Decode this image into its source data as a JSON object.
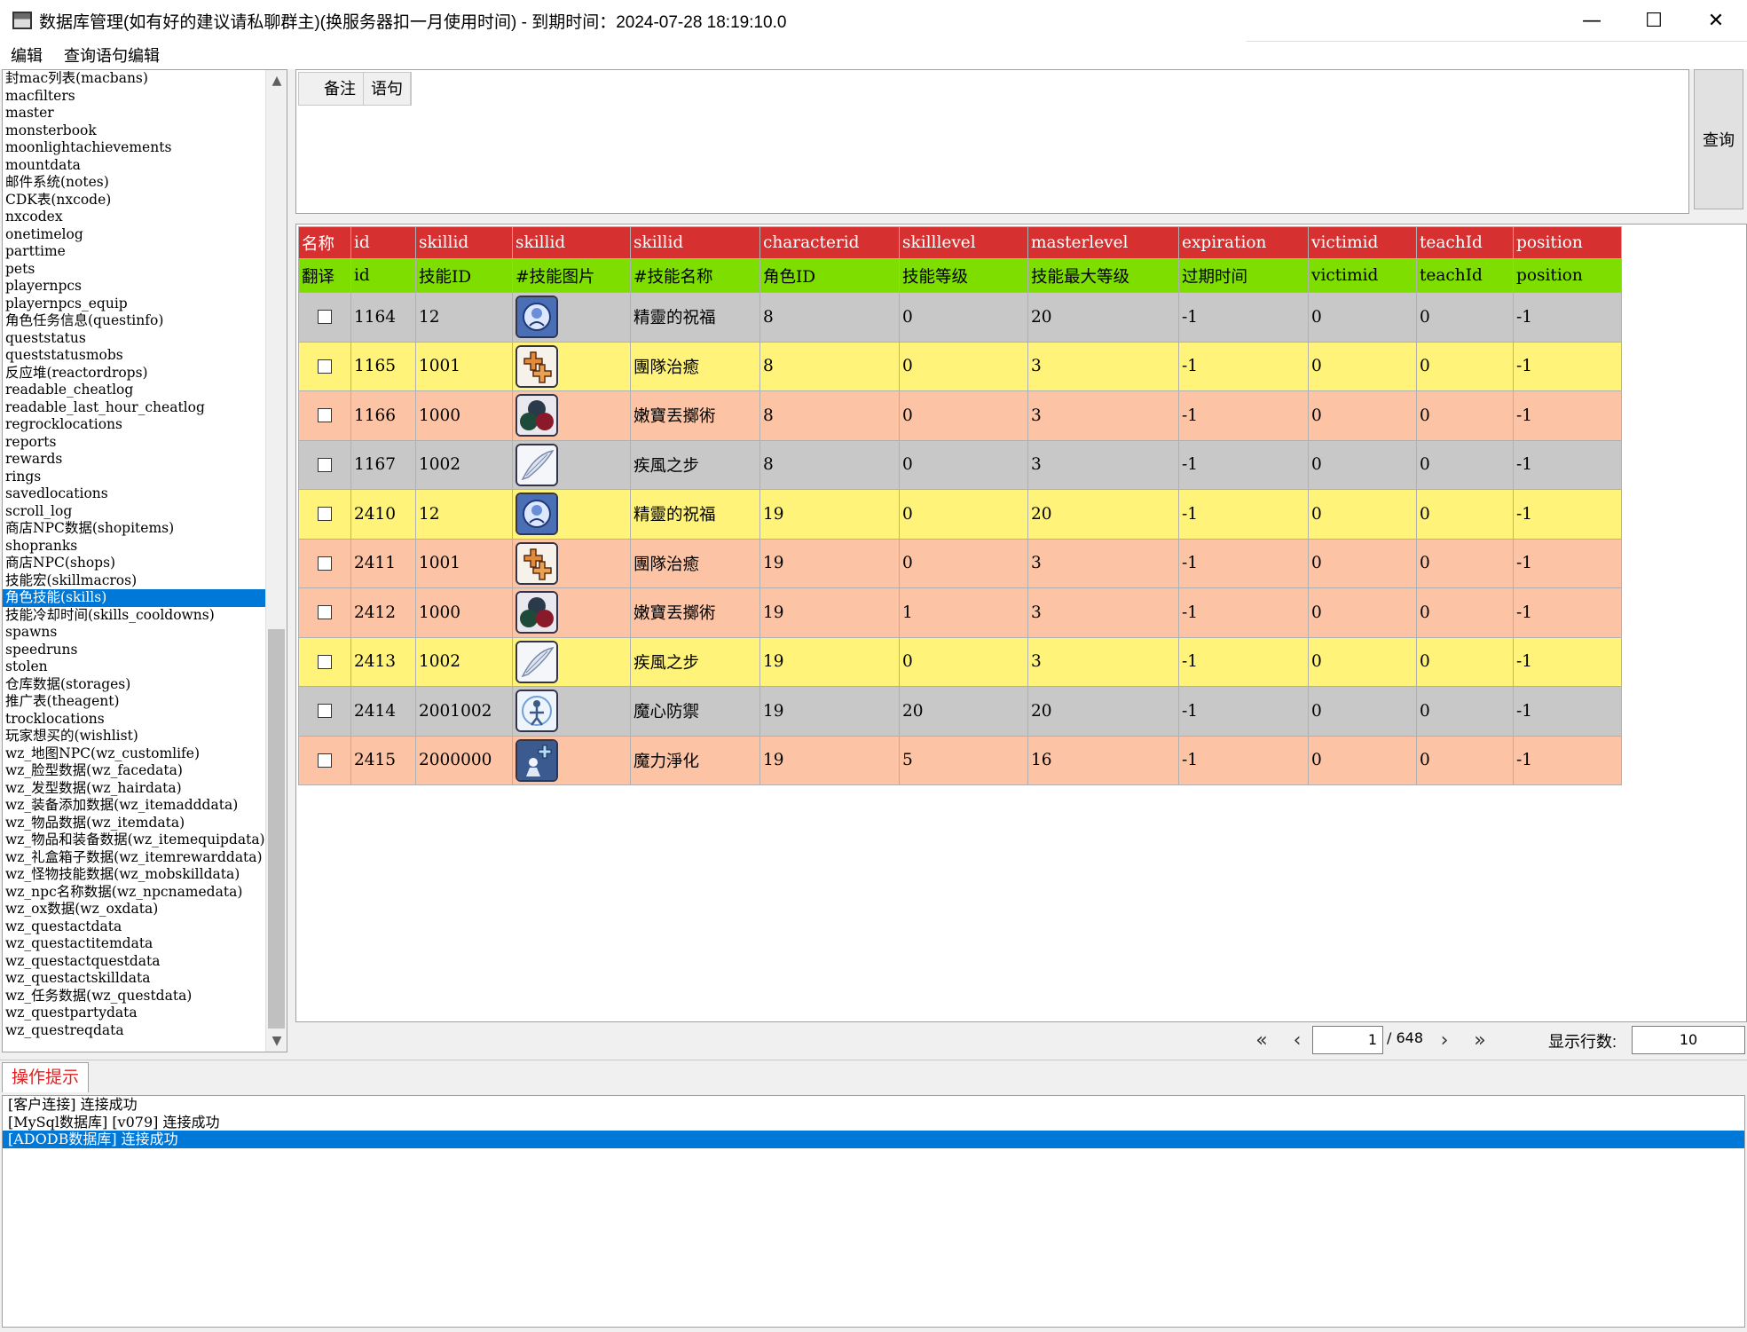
{
  "window": {
    "title": "数据库管理(如有好的建议请私聊群主)(换服务器扣一月使用时间) - 到期时间：2024-07-28 18:19:10.0",
    "minimize": "—",
    "maximize": "☐",
    "close": "✕"
  },
  "menu": [
    "编辑",
    "查询语句编辑"
  ],
  "table_list": {
    "selected_index": 30,
    "items": [
      "封mac列表(macbans)",
      "macfilters",
      "master",
      "monsterbook",
      "moonlightachievements",
      "mountdata",
      "邮件系统(notes)",
      "CDK表(nxcode)",
      "nxcodex",
      "onetimelog",
      "parttime",
      "pets",
      "playernpcs",
      "playernpcs_equip",
      "角色任务信息(questinfo)",
      "queststatus",
      "queststatusmobs",
      "反应堆(reactordrops)",
      "readable_cheatlog",
      "readable_last_hour_cheatlog",
      "regrocklocations",
      "reports",
      "rewards",
      "rings",
      "savedlocations",
      "scroll_log",
      "商店NPC数据(shopitems)",
      "shopranks",
      "商店NPC(shops)",
      "技能宏(skillmacros)",
      "角色技能(skills)",
      "技能冷却时间(skills_cooldowns)",
      "spawns",
      "speedruns",
      "stolen",
      "仓库数据(storages)",
      "推广表(theagent)",
      "trocklocations",
      "玩家想买的(wishlist)",
      "wz_地图NPC(wz_customlife)",
      "wz_脸型数据(wz_facedata)",
      "wz_发型数据(wz_hairdata)",
      "wz_装备添加数据(wz_itemadddata)",
      "wz_物品数据(wz_itemdata)",
      "wz_物品和装备数据(wz_itemequipdata)",
      "wz_礼盒箱子数据(wz_itemrewarddata)",
      "wz_怪物技能数据(wz_mobskilldata)",
      "wz_npc名称数据(wz_npcnamedata)",
      "wz_ox数据(wz_oxdata)",
      "wz_questactdata",
      "wz_questactitemdata",
      "wz_questactquestdata",
      "wz_questactskilldata",
      "wz_任务数据(wz_questdata)",
      "wz_questpartydata",
      "wz_questreqdata"
    ]
  },
  "query": {
    "tabs": [
      "备注",
      "语句"
    ],
    "button": "查询"
  },
  "grid": {
    "header_names": [
      "名称",
      "id",
      "skillid",
      "skillid",
      "skillid",
      "characterid",
      "skilllevel",
      "masterlevel",
      "expiration",
      "victimid",
      "teachId",
      "position"
    ],
    "header_translations": [
      "翻译",
      "id",
      "技能ID",
      "#技能图片",
      "#技能名称",
      "角色ID",
      "技能等级",
      "技能最大等级",
      "过期时间",
      "victimid",
      "teachId",
      "position"
    ],
    "rows": [
      {
        "id": "1164",
        "skillid": "12",
        "icon": "blessing-icon",
        "name": "精靈的祝福",
        "characterid": "8",
        "skilllevel": "0",
        "masterlevel": "20",
        "expiration": "-1",
        "victimid": "0",
        "teachid": "0",
        "position": "-1",
        "color": "gray"
      },
      {
        "id": "1165",
        "skillid": "1001",
        "icon": "heal-icon",
        "name": "團隊治癒",
        "characterid": "8",
        "skilllevel": "0",
        "masterlevel": "3",
        "expiration": "-1",
        "victimid": "0",
        "teachid": "0",
        "position": "-1",
        "color": "yellow"
      },
      {
        "id": "1166",
        "skillid": "1000",
        "icon": "stone-throw-icon",
        "name": "嫩寶丟擲術",
        "characterid": "8",
        "skilllevel": "0",
        "masterlevel": "3",
        "expiration": "-1",
        "victimid": "0",
        "teachid": "0",
        "position": "-1",
        "color": "salmon"
      },
      {
        "id": "1167",
        "skillid": "1002",
        "icon": "wing-icon",
        "name": "疾風之步",
        "characterid": "8",
        "skilllevel": "0",
        "masterlevel": "3",
        "expiration": "-1",
        "victimid": "0",
        "teachid": "0",
        "position": "-1",
        "color": "gray"
      },
      {
        "id": "2410",
        "skillid": "12",
        "icon": "blessing-icon",
        "name": "精靈的祝福",
        "characterid": "19",
        "skilllevel": "0",
        "masterlevel": "20",
        "expiration": "-1",
        "victimid": "0",
        "teachid": "0",
        "position": "-1",
        "color": "yellow"
      },
      {
        "id": "2411",
        "skillid": "1001",
        "icon": "heal-icon",
        "name": "團隊治癒",
        "characterid": "19",
        "skilllevel": "0",
        "masterlevel": "3",
        "expiration": "-1",
        "victimid": "0",
        "teachid": "0",
        "position": "-1",
        "color": "salmon"
      },
      {
        "id": "2412",
        "skillid": "1000",
        "icon": "stone-throw-icon",
        "name": "嫩寶丟擲術",
        "characterid": "19",
        "skilllevel": "1",
        "masterlevel": "3",
        "expiration": "-1",
        "victimid": "0",
        "teachid": "0",
        "position": "-1",
        "color": "salmon"
      },
      {
        "id": "2413",
        "skillid": "1002",
        "icon": "wing-icon",
        "name": "疾風之步",
        "characterid": "19",
        "skilllevel": "0",
        "masterlevel": "3",
        "expiration": "-1",
        "victimid": "0",
        "teachid": "0",
        "position": "-1",
        "color": "yellow"
      },
      {
        "id": "2414",
        "skillid": "2001002",
        "icon": "magic-guard-icon",
        "name": "魔心防禦",
        "characterid": "19",
        "skilllevel": "20",
        "masterlevel": "20",
        "expiration": "-1",
        "victimid": "0",
        "teachid": "0",
        "position": "-1",
        "color": "gray"
      },
      {
        "id": "2415",
        "skillid": "2000000",
        "icon": "mp-recovery-icon",
        "name": "魔力淨化",
        "characterid": "19",
        "skilllevel": "5",
        "masterlevel": "16",
        "expiration": "-1",
        "victimid": "0",
        "teachid": "0",
        "position": "-1",
        "color": "salmon"
      }
    ]
  },
  "pager": {
    "first": "«",
    "prev": "‹",
    "next": "›",
    "last": "»",
    "current_page": "1",
    "total_pages": "/ 648",
    "rows_label": "显示行数:",
    "rows_per_page": "10"
  },
  "log": {
    "tab_label": "操作提示",
    "selected_index": 2,
    "lines": [
      "[客户连接] 连接成功",
      "[MySql数据库] [v079] 连接成功",
      "[ADODB数据库] 连接成功"
    ]
  }
}
